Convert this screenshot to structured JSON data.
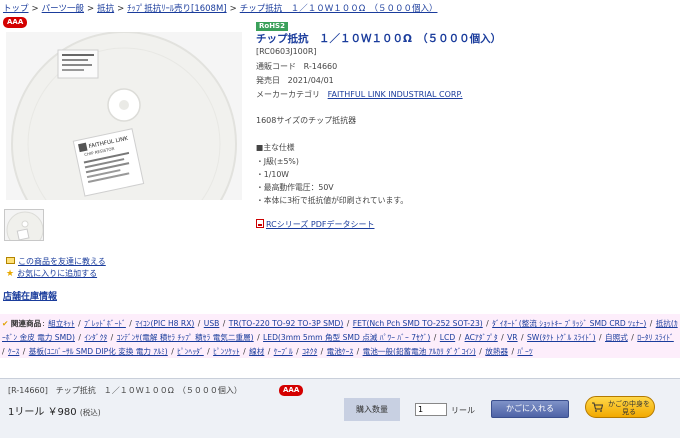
{
  "breadcrumb": {
    "items": [
      "トップ",
      "パーツ一般",
      "抵抗",
      "ﾁｯﾌﾟ抵抗ﾘｰﾙ売り[1608M]",
      "チップ抵抗　１／１０Ｗ１００Ω　（５０００個入）"
    ],
    "separator": ">"
  },
  "badge": {
    "label": "AAA",
    "color": "#d40000"
  },
  "rohs": {
    "label": "RoHS2",
    "color": "#3aa05a"
  },
  "product": {
    "title": "チップ抵抗　１／１０Ｗ１００Ω　（５０００個入）",
    "model": "[RC0603J100R]",
    "code_label": "通販コード",
    "code": "R-14660",
    "release_label": "発売日",
    "release_date": "2021/04/01",
    "maker_label": "メーカーカテゴリ",
    "maker": "FAITHFUL LINK INDUSTRIAL CORP.",
    "summary": "1608サイズのチップ抵抗器",
    "spec_heading": "■主な仕様",
    "specs": [
      "・J級(±5%)",
      "・1/10W",
      "・最高動作電圧：50V",
      "・本体に3桁で抵抗値が印刷されています。"
    ],
    "pdf_link": "RCシリーズ PDFデータシート"
  },
  "photo": {
    "label_brand": "FAITHFUL LINK",
    "label_sub": "CHIP RESISTOR"
  },
  "actions": {
    "tell_friend": "この商品を友達に教える",
    "favorite": "お気に入りに追加する"
  },
  "store_link": "店舗在庫情報",
  "related": {
    "heading": "関連商品",
    "items": [
      "組立ｷｯﾄ",
      "ﾌﾞﾚｯﾄﾞﾎﾞｰﾄﾞ",
      "ﾏｲｺﾝ(PIC H8 RX)",
      "USB",
      "TR(TO-220 TO-92 TO-3P SMD)",
      "FET(Nch Pch SMD TO-252 SOT-23)",
      "ﾀﾞｲｵｰﾄﾞ(整流 ｼｮｯﾄｷｰ ﾌﾞﾘｯｼﾞ SMD CRD ﾂｪﾅｰ)",
      "抵抗(ｶｰﾎﾞﾝ 金皮 電力 SMD)",
      "ｲﾝﾀﾞｸﾀ",
      "ｺﾝﾃﾞﾝｻ(電解 積ｾﾗ ﾁｯﾌﾟ 積ｾﾗ 電気二重層)",
      "LED(3mm 5mm 角型 SMD 点滅 ﾊﾟﾜｰ ﾊﾞｰ 7ｾｸﾞ)",
      "LCD",
      "ACｱﾀﾞﾌﾟﾀ",
      "VR",
      "SW(ﾀｸﾄ ﾄｸﾞﾙ ｽﾗｲﾄﾞ)",
      "自照式",
      "ﾛｰﾀﾘ ｽﾗｲﾄﾞ",
      "ｹｰｽ",
      "基板(ﾕﾆﾊﾞｰｻﾙ SMD DIP化 変換 電力 ｱﾙﾐ)",
      "ﾋﾟﾝﾍｯﾀﾞ",
      "ﾋﾟﾝｿｹｯﾄ",
      "線材",
      "ｹｰﾌﾞﾙ",
      "ｺﾈｸﾀ",
      "電池ｹｰｽ",
      "電池一般(鉛蓄電池 ｱﾙｶﾘ ﾀﾞｸﾞｺｲﾝ)",
      "放熱器",
      "ﾊﾟｰﾂ"
    ]
  },
  "cart": {
    "ref": "[R-14660]　チップ抵抗　１／１０Ｗ１００Ω　（５０００個入）",
    "price_unit": "1リール",
    "price": "￥980",
    "tax": "(税込)",
    "qty_label": "購入数量",
    "qty_value": "1",
    "qty_unit": "リール",
    "add_button": "かごに入れる",
    "peek_button": "かごの中身を見る"
  }
}
